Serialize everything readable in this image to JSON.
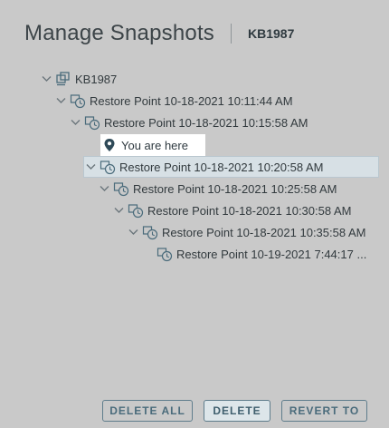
{
  "dialog": {
    "title": "Manage Snapshots",
    "vm_name": "KB1987"
  },
  "tree": {
    "root": {
      "label": "KB1987",
      "icon": "vm-icon"
    },
    "items": [
      {
        "label": "Restore Point 10-18-2021 10:11:44 AM",
        "icon": "snapshot-icon"
      },
      {
        "label": "Restore Point 10-18-2021 10:15:58 AM",
        "icon": "snapshot-icon"
      },
      {
        "label": "Restore Point 10-18-2021 10:20:58 AM",
        "icon": "snapshot-icon",
        "selected": true
      },
      {
        "label": "Restore Point 10-18-2021 10:25:58 AM",
        "icon": "snapshot-icon"
      },
      {
        "label": "Restore Point 10-18-2021 10:30:58 AM",
        "icon": "snapshot-icon"
      },
      {
        "label": "Restore Point 10-18-2021 10:35:58 AM",
        "icon": "snapshot-icon"
      },
      {
        "label": "Restore Point 10-19-2021 7:44:17 ...",
        "icon": "snapshot-icon"
      }
    ],
    "current_marker": {
      "label": "You are here",
      "icon": "map-pin-icon"
    }
  },
  "buttons": {
    "delete_all": "DELETE ALL",
    "delete": "DELETE",
    "revert_to": "REVERT TO"
  },
  "colors": {
    "background": "#c9c9c9",
    "selected_row": "#d7e0e5",
    "button_text": "#4a6b7b"
  }
}
